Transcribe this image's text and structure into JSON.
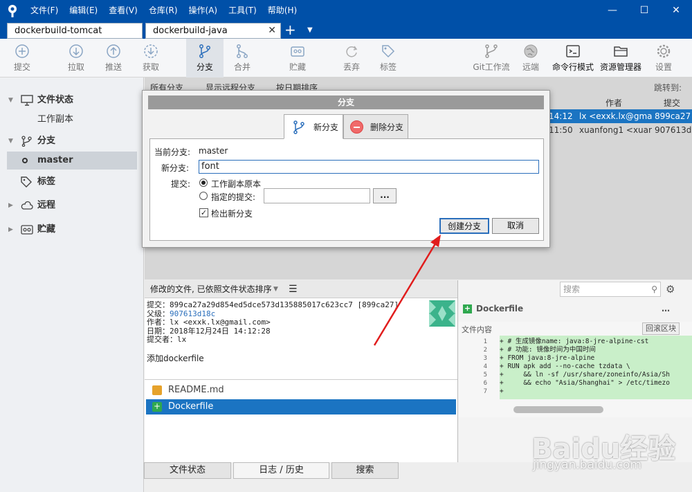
{
  "titlebar": {
    "menu": [
      "文件(F)",
      "编辑(E)",
      "查看(V)",
      "仓库(R)",
      "操作(A)",
      "工具(T)",
      "帮助(H)"
    ],
    "minimize": "—",
    "maximize": "☐",
    "close": "✕"
  },
  "tabs": {
    "tab1": "dockerbuild-tomcat",
    "tab2": "dockerbuild-java",
    "close": "✕",
    "add": "+",
    "dropdown": "▼"
  },
  "toolbar": {
    "commit": "提交",
    "pull": "拉取",
    "push": "推送",
    "fetch": "获取",
    "branch": "分支",
    "merge": "合并",
    "stash": "贮藏",
    "discard": "丢弃",
    "tag": "标签",
    "gitflow": "Git工作流",
    "remote": "远端",
    "terminal": "命令行模式",
    "explorer": "资源管理器",
    "settings": "设置"
  },
  "sidebar": {
    "file_status": "文件状态",
    "working_copy": "工作副本",
    "branches": "分支",
    "master": "master",
    "tags": "标签",
    "remotes": "远程",
    "stashes": "贮藏"
  },
  "main": {
    "filter_all": "所有分支",
    "show_remote": "显示远程分支",
    "sort_date": "按日期排序",
    "jump_to": "跳转到:",
    "col_author": "作者",
    "col_commit": "提交",
    "rows": [
      {
        "time": "14:12",
        "author": "lx <exxk.lx@gma",
        "hash": "899ca27"
      },
      {
        "time": "11:50",
        "author": "xuanfong1 <xuar",
        "hash": "907613d"
      }
    ]
  },
  "filebar": {
    "label": "修改的文件, 已依照文件状态排序",
    "search_placeholder": "搜索"
  },
  "commit": {
    "commit_label": "提交：",
    "commit_value": "899ca27a29d854ed5dce573d135885017c623cc7 [899ca27]",
    "parent_label": "父级：",
    "parent_value": "907613d18c",
    "author_label": "作者：",
    "author_value": "lx <exxk.lx@gmail.com>",
    "date_label": "日期：",
    "date_value": "2018年12月24日 14:12:28",
    "committer_label": "提交者：",
    "committer_value": "lx",
    "message": "添加dockerfile"
  },
  "files": [
    {
      "name": "README.md",
      "status": "modified"
    },
    {
      "name": "Dockerfile",
      "status": "added"
    }
  ],
  "diff": {
    "filename": "Dockerfile",
    "content_label": "文件内容",
    "rollback_button": "回滚区块",
    "lines": [
      {
        "n": "1",
        "t": "+ # 生成镜像name: java:8-jre-alpine-cst"
      },
      {
        "n": "2",
        "t": "+ # 功能: 镜像时间为中国时间"
      },
      {
        "n": "3",
        "t": "+ FROM java:8-jre-alpine"
      },
      {
        "n": "4",
        "t": "+ RUN apk add --no-cache tzdata \\"
      },
      {
        "n": "5",
        "t": "+     && ln -sf /usr/share/zoneinfo/Asia/Sh"
      },
      {
        "n": "6",
        "t": "+     && echo \"Asia/Shanghai\" > /etc/timezo"
      },
      {
        "n": "7",
        "t": "+"
      }
    ]
  },
  "bottom_tabs": {
    "status": "文件状态",
    "log": "日志 / 历史",
    "search": "搜索"
  },
  "dialog": {
    "title": "分支",
    "tab_new": "新分支",
    "tab_delete": "删除分支",
    "current_label": "当前分支:",
    "current_value": "master",
    "new_label": "新分支:",
    "new_value": "font",
    "commit_label": "提交:",
    "opt_working": "工作副本原本",
    "opt_specified": "指定的提交:",
    "browse": "...",
    "checkout": "检出新分支",
    "create_button": "创建分支",
    "cancel_button": "取消"
  },
  "watermark": {
    "brand": "Baidu经验",
    "url": "jingyan.baidu.com"
  },
  "colors": {
    "titlebar": "#0050a8",
    "selection": "#1b74c2",
    "diff_added": "#c9efc9",
    "arrow": "#e11d1d"
  }
}
